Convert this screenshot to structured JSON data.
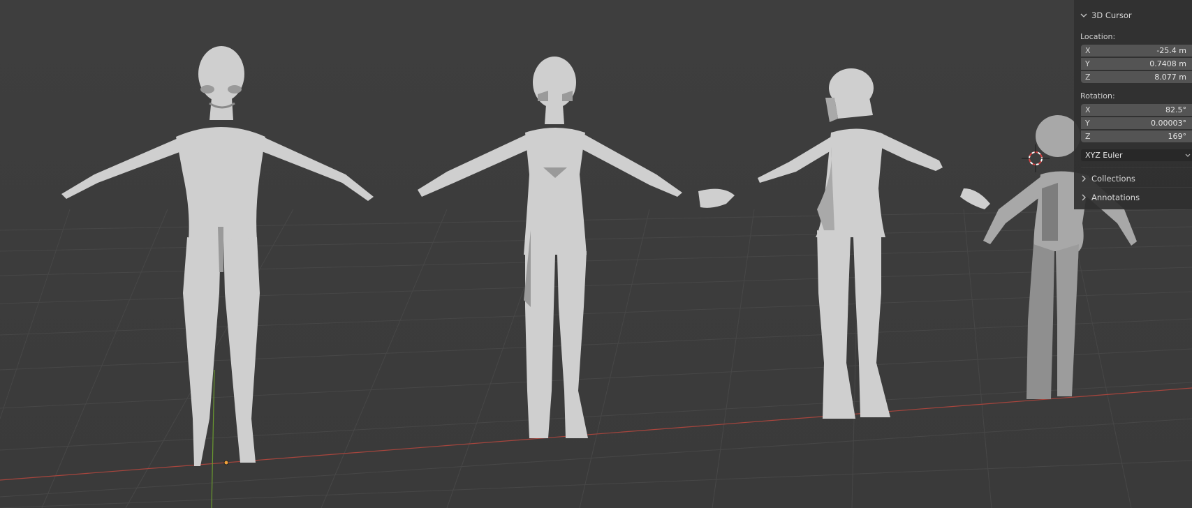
{
  "sidebar": {
    "cursor_panel": {
      "title": "3D Cursor",
      "location_label": "Location:",
      "location": [
        {
          "axis": "X",
          "value": "-25.4 m"
        },
        {
          "axis": "Y",
          "value": "0.7408 m"
        },
        {
          "axis": "Z",
          "value": "8.077 m"
        }
      ],
      "rotation_label": "Rotation:",
      "rotation": [
        {
          "axis": "X",
          "value": "82.5°"
        },
        {
          "axis": "Y",
          "value": "0.00003°"
        },
        {
          "axis": "Z",
          "value": "169°"
        }
      ],
      "rotation_mode": "XYZ Euler"
    },
    "collections_label": "Collections",
    "annotations_label": "Annotations"
  },
  "viewport": {
    "background": "#3d3d3d",
    "grid_color": "#474747",
    "x_axis_color": "#a8453d",
    "y_axis_color": "#6a9a2f",
    "mesh_color": "#cfcfcf"
  }
}
